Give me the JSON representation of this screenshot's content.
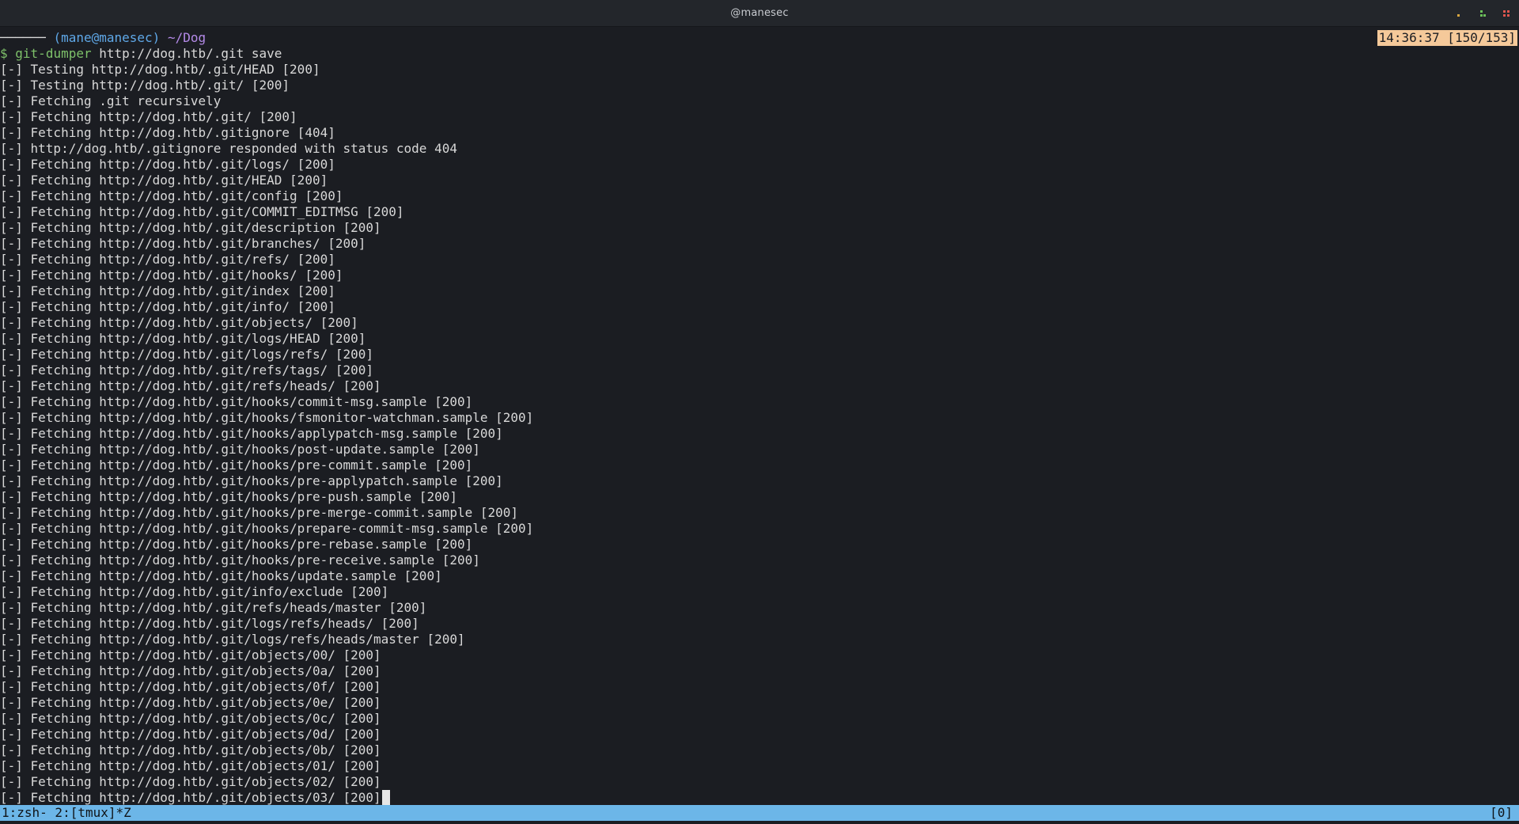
{
  "window": {
    "title": "@manesec",
    "controls": [
      {
        "name": "minimize-button",
        "icon": "minimize-icon",
        "color": "#d9a740"
      },
      {
        "name": "maximize-button",
        "icon": "maximize-icon",
        "color": "#6cc05a"
      },
      {
        "name": "close-button",
        "icon": "close-icon",
        "color": "#e0564f"
      }
    ]
  },
  "prompt": {
    "dashes": "──────",
    "user": "(mane@manesec)",
    "path": "~/Dog",
    "symbol": "$",
    "command": "git-dumper",
    "args": "http://dog.htb/.git save"
  },
  "clock": "14:36:37 [150/153]",
  "output": [
    "[-] Testing http://dog.htb/.git/HEAD [200]",
    "[-] Testing http://dog.htb/.git/ [200]",
    "[-] Fetching .git recursively",
    "[-] Fetching http://dog.htb/.git/ [200]",
    "[-] Fetching http://dog.htb/.gitignore [404]",
    "[-] http://dog.htb/.gitignore responded with status code 404",
    "[-] Fetching http://dog.htb/.git/logs/ [200]",
    "[-] Fetching http://dog.htb/.git/HEAD [200]",
    "[-] Fetching http://dog.htb/.git/config [200]",
    "[-] Fetching http://dog.htb/.git/COMMIT_EDITMSG [200]",
    "[-] Fetching http://dog.htb/.git/description [200]",
    "[-] Fetching http://dog.htb/.git/branches/ [200]",
    "[-] Fetching http://dog.htb/.git/refs/ [200]",
    "[-] Fetching http://dog.htb/.git/hooks/ [200]",
    "[-] Fetching http://dog.htb/.git/index [200]",
    "[-] Fetching http://dog.htb/.git/info/ [200]",
    "[-] Fetching http://dog.htb/.git/objects/ [200]",
    "[-] Fetching http://dog.htb/.git/logs/HEAD [200]",
    "[-] Fetching http://dog.htb/.git/logs/refs/ [200]",
    "[-] Fetching http://dog.htb/.git/refs/tags/ [200]",
    "[-] Fetching http://dog.htb/.git/refs/heads/ [200]",
    "[-] Fetching http://dog.htb/.git/hooks/commit-msg.sample [200]",
    "[-] Fetching http://dog.htb/.git/hooks/fsmonitor-watchman.sample [200]",
    "[-] Fetching http://dog.htb/.git/hooks/applypatch-msg.sample [200]",
    "[-] Fetching http://dog.htb/.git/hooks/post-update.sample [200]",
    "[-] Fetching http://dog.htb/.git/hooks/pre-commit.sample [200]",
    "[-] Fetching http://dog.htb/.git/hooks/pre-applypatch.sample [200]",
    "[-] Fetching http://dog.htb/.git/hooks/pre-push.sample [200]",
    "[-] Fetching http://dog.htb/.git/hooks/pre-merge-commit.sample [200]",
    "[-] Fetching http://dog.htb/.git/hooks/prepare-commit-msg.sample [200]",
    "[-] Fetching http://dog.htb/.git/hooks/pre-rebase.sample [200]",
    "[-] Fetching http://dog.htb/.git/hooks/pre-receive.sample [200]",
    "[-] Fetching http://dog.htb/.git/hooks/update.sample [200]",
    "[-] Fetching http://dog.htb/.git/info/exclude [200]",
    "[-] Fetching http://dog.htb/.git/refs/heads/master [200]",
    "[-] Fetching http://dog.htb/.git/logs/refs/heads/ [200]",
    "[-] Fetching http://dog.htb/.git/logs/refs/heads/master [200]",
    "[-] Fetching http://dog.htb/.git/objects/00/ [200]",
    "[-] Fetching http://dog.htb/.git/objects/0a/ [200]",
    "[-] Fetching http://dog.htb/.git/objects/0f/ [200]",
    "[-] Fetching http://dog.htb/.git/objects/0e/ [200]",
    "[-] Fetching http://dog.htb/.git/objects/0c/ [200]",
    "[-] Fetching http://dog.htb/.git/objects/0d/ [200]",
    "[-] Fetching http://dog.htb/.git/objects/0b/ [200]",
    "[-] Fetching http://dog.htb/.git/objects/01/ [200]",
    "[-] Fetching http://dog.htb/.git/objects/02/ [200]",
    "[-] Fetching http://dog.htb/.git/objects/03/ [200]"
  ],
  "statusbar": {
    "windows": "1:zsh- 2:[tmux]*Z",
    "session": "[0]"
  },
  "colors": {
    "background": "#1b1d22",
    "status_bar": "#6cb6e8",
    "clock_bg": "#f5c99a"
  }
}
